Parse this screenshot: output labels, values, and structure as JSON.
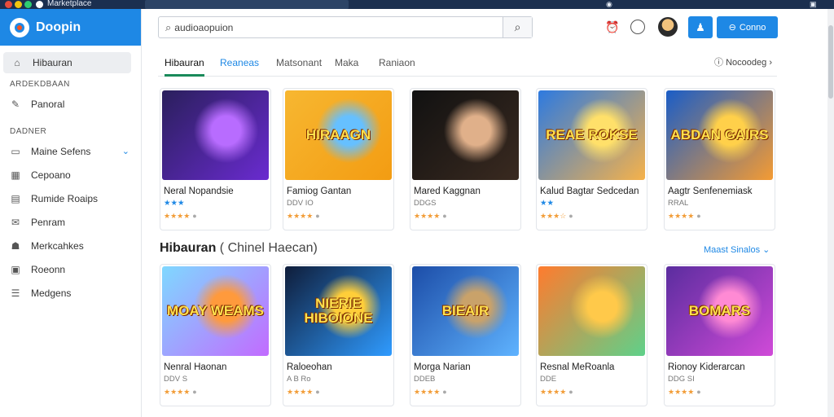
{
  "window": {
    "title": "Marketplace",
    "address": ""
  },
  "brand": {
    "name": "Doopin"
  },
  "sidebar": {
    "active": {
      "label": "Hibauran",
      "icon": "home-icon"
    },
    "sections": [
      {
        "title": "ARDEKDBAAN",
        "items": [
          {
            "label": "Panoral",
            "icon": "tool-icon"
          }
        ]
      },
      {
        "title": "DADNER",
        "items": [
          {
            "label": "Maine Sefens",
            "icon": "window-icon",
            "expandable": true
          },
          {
            "label": "Cepoano",
            "icon": "grid-icon"
          },
          {
            "label": "Rumide Roaips",
            "icon": "list-icon"
          },
          {
            "label": "Penram",
            "icon": "chat-icon"
          },
          {
            "label": "Merkcahkes",
            "icon": "people-icon"
          },
          {
            "label": "Roeonn",
            "icon": "doc-icon"
          },
          {
            "label": "Medgens",
            "icon": "stack-icon"
          }
        ]
      }
    ]
  },
  "search": {
    "value": "audioaopuion"
  },
  "header": {
    "connect_label": "Conno"
  },
  "tabs": [
    {
      "label": "Hibauran",
      "state": "active"
    },
    {
      "label": "Reaneas",
      "state": "blue"
    },
    {
      "label": "Matsonant",
      "state": "normal"
    },
    {
      "label": "Maka",
      "state": "normal"
    },
    {
      "label": "Raniaon",
      "state": "normal"
    }
  ],
  "tabs_right": {
    "label": "Nocoodeg"
  },
  "row1": [
    {
      "title": "Neral Nopandsie",
      "sub": "★★★",
      "sub_style": "blue",
      "rating": 3.5,
      "art_text": "",
      "palette": [
        "#2a1f5c",
        "#6a2bd0",
        "#b86cff"
      ]
    },
    {
      "title": "Famiog Gantan",
      "sub": "DDV IO",
      "sub_style": "grey",
      "rating": 3.5,
      "art_text": "HIRAAGN",
      "palette": [
        "#f7b731",
        "#f39c12",
        "#66c0ff"
      ]
    },
    {
      "title": "Mared Kaggnan",
      "sub": "DDGS",
      "sub_style": "grey",
      "rating": 3.5,
      "art_text": "",
      "palette": [
        "#111",
        "#3a2a20",
        "#e0b08a"
      ]
    },
    {
      "title": "Kalud Bagtar Sedcedan",
      "sub": "★★",
      "sub_style": "blue",
      "rating": 2.5,
      "art_text": "REAE ROKSE",
      "palette": [
        "#2d7ae0",
        "#f6b24a",
        "#ffe06a"
      ]
    },
    {
      "title": "Aagtr Senfenemiask",
      "sub": "RRAL",
      "sub_style": "grey",
      "rating": 3.5,
      "art_text": "ABDAN GAIRS",
      "palette": [
        "#1a5dc7",
        "#f49b33",
        "#ffd04a"
      ]
    }
  ],
  "section2": {
    "title": "Hibauran",
    "subtitle": "( Chinel Haecan)",
    "link": "Maast Sinalos"
  },
  "row2": [
    {
      "title": "Nenral Haonan",
      "sub": "DDV S",
      "rating": 3.5,
      "art_text": "MOAY WEAMS",
      "palette": [
        "#7fd8ff",
        "#c26bff",
        "#ff9a3c"
      ]
    },
    {
      "title": "Raloeohan",
      "sub": "A B Ro",
      "rating": 3.5,
      "art_text": "NIERIE HIBOIONE",
      "palette": [
        "#0f1d3a",
        "#2f9bff",
        "#ffce39"
      ]
    },
    {
      "title": "Morga Narian",
      "sub": "DDEB",
      "rating": 3.5,
      "art_text": "BIEAIR",
      "palette": [
        "#1c4da8",
        "#5fb3ff",
        "#c9a26a"
      ]
    },
    {
      "title": "Resnal MeRoanla",
      "sub": "DDE",
      "rating": 3.5,
      "art_text": "",
      "palette": [
        "#ff7b2e",
        "#5ed18a",
        "#ffc94a"
      ]
    },
    {
      "title": "Rionoy Kiderarcan",
      "sub": "DDG SI",
      "rating": 3.5,
      "art_text": "BOMARS",
      "palette": [
        "#5b2d9f",
        "#d04ad8",
        "#ff8ad4"
      ]
    }
  ],
  "colors": {
    "accent": "#1e88e5",
    "active_tab_underline": "#1a8a5a",
    "star": "#f29d38"
  }
}
